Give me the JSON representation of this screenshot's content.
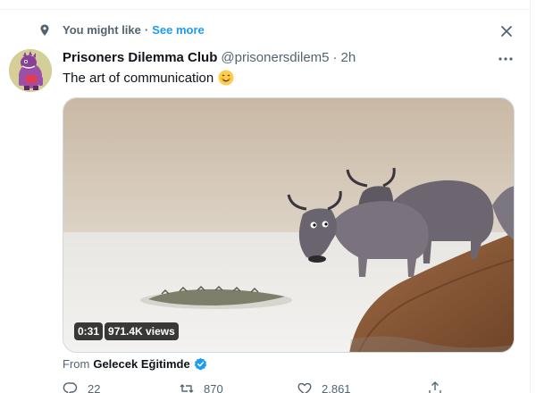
{
  "context": {
    "label": "You might like",
    "separator": "·",
    "see_more": "See more",
    "icon": "location-pin-icon"
  },
  "tweet": {
    "author_name": "Prisoners Dilemma Club",
    "handle": "@prisonersdilem5",
    "separator": "·",
    "time": "2h",
    "text": "The art of communication",
    "emoji": "smiling-face-emoji",
    "video": {
      "duration": "0:31",
      "views": "971.4K views"
    },
    "from_label": "From",
    "from_source": "Gelecek Eğitimde",
    "actions": {
      "replies": "22",
      "retweets": "870",
      "likes": "2,861"
    }
  },
  "colors": {
    "accent": "#1d9bf0",
    "text": "#0f1419",
    "muted": "#536471",
    "border": "#eff3f4"
  }
}
